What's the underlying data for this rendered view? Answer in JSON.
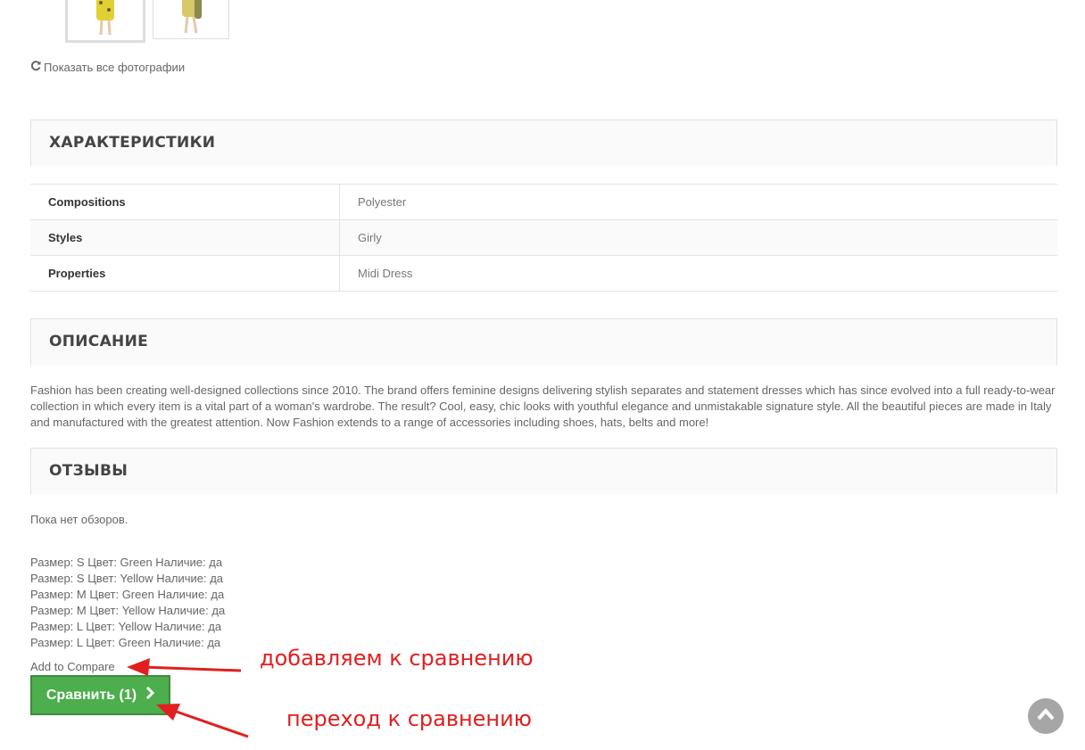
{
  "gallery": {
    "show_all_label": "Показать все фотографии"
  },
  "specs": {
    "title": "ХАРАКТЕРИСТИКИ",
    "rows": [
      {
        "key": "Compositions",
        "value": "Polyester"
      },
      {
        "key": "Styles",
        "value": "Girly"
      },
      {
        "key": "Properties",
        "value": "Midi Dress"
      }
    ]
  },
  "description": {
    "title": "ОПИСАНИЕ",
    "text": "Fashion has been creating well-designed collections since 2010. The brand offers feminine designs delivering stylish separates and statement dresses which has since evolved into a full ready-to-wear collection in which every item is a vital part of a woman's wardrobe. The result? Cool, easy, chic looks with youthful elegance and unmistakable signature style. All the beautiful pieces are made in Italy and manufactured with the greatest attention. Now Fashion extends to a range of accessories including shoes, hats, belts and more!"
  },
  "reviews": {
    "title": "ОТЗЫВЫ",
    "empty_text": "Пока нет обзоров."
  },
  "variants": [
    "Размер: S Цвет: Green Наличие: да",
    "Размер: S Цвет: Yellow Наличие: да",
    "Размер: M Цвет: Green Наличие: да",
    "Размер: M Цвет: Yellow Наличие: да",
    "Размер: L Цвет: Yellow Наличие: да",
    "Размер: L Цвет: Green Наличие: да"
  ],
  "compare": {
    "add_label": "Add to Compare",
    "button_label": "Сравнить (1)"
  },
  "annotations": {
    "add": "добавляем к сравнению",
    "go": "переход к сравнению"
  },
  "colors": {
    "accent_green": "#4cae4c",
    "annotation_red": "#e02020"
  }
}
